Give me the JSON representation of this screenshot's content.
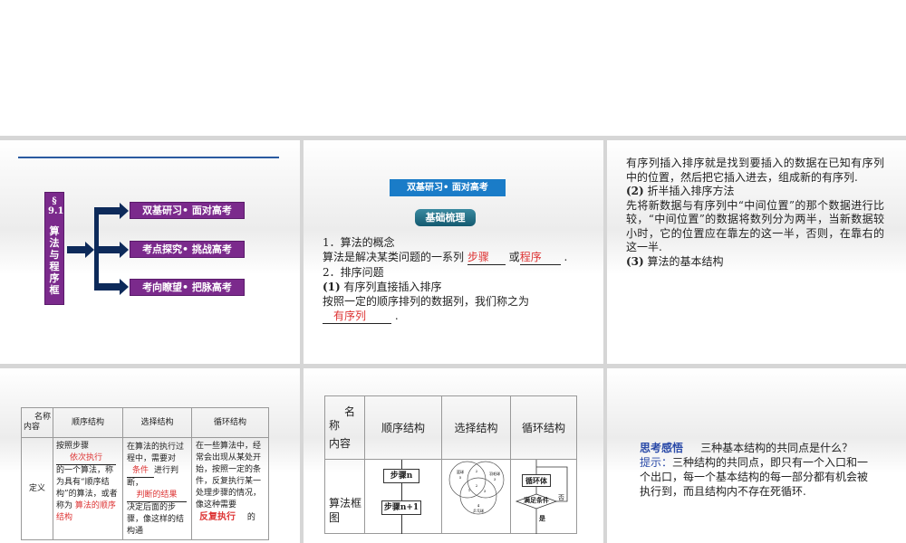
{
  "slide1": {
    "section": "§ 9.1",
    "title_chars": [
      "算",
      "法",
      "与",
      "程",
      "序",
      "框"
    ],
    "branches": [
      "双基研习• 面对高考",
      "考点探究• 挑战高考",
      "考向瞭望• 把脉高考"
    ]
  },
  "slide2": {
    "banner": "双基研习• 面对高考",
    "badge": "基础梳理",
    "l1": "1．算法的概念",
    "l2_pre": "算法是解决某类问题的一系列",
    "blank1": "步骤",
    "l2_mid": "或",
    "blank2": "程序",
    "l2_end": ".",
    "l3": "2．排序问题",
    "l4_num": "(1)",
    "l4": "有序列直接插入排序",
    "l5": "按照一定的顺序排列的数据列，我们称之为",
    "blank3": "有序列",
    "l6_end": "."
  },
  "slide3": {
    "p1": "有序列插入排序就是找到要插入的数据在已知有序列中的位置，然后把它插入进去，组成新的有序列.",
    "h2_num": "(2)",
    "h2": "折半插入排序方法",
    "p2": "先将新数据与有序列中“中间位置”的那个数据进行比较，“中间位置”的数据将数列分为两半，当新数据较小时，它的位置应在靠左的这一半，否则，在靠右的这一半.",
    "h3_num": "(3)",
    "h3": "算法的基本结构"
  },
  "slide4": {
    "corner_top": "名称",
    "corner_bottom": "内容",
    "cols": [
      "顺序结构",
      "选择结构",
      "循环结构"
    ],
    "row_label": "定义",
    "c1a": "按照步骤",
    "c1_blank": "依次执行",
    "c1b": "的一个算法，称为具有“顺序结构”的算法，或者称为",
    "c1_blank2": "算法的顺序结构",
    "c2a": "在算法的执行过程中，需要对",
    "c2_blank": "条件",
    "c2b": "进行判断，",
    "c2_blank2": "判断的结果",
    "c2c": "决定后面的步骤，像这样的结构通",
    "c3a": "在一些算法中，经常会出现从某处开始，按照一定的条件，反复执行某一处理步骤的情况，像这种需要",
    "c3_blank": "反复执行",
    "c3b": "的"
  },
  "slide5": {
    "corner_top": "名",
    "corner_mid": "称",
    "corner_bottom": "内容",
    "cols": [
      "顺序结构",
      "选择结构",
      "循环结构"
    ],
    "row_label": "算法框图",
    "seq_box1": "步骤n",
    "seq_box2": "步骤n+1",
    "venn": {
      "a": "篮球",
      "a_n": "5",
      "b": "羽毛球",
      "b_n": "3",
      "c": "乒乓球",
      "c_n": "4",
      "ab": "2",
      "abc": "2",
      "ac": "1",
      "bc": "3"
    },
    "loop_body": "循环体",
    "loop_cond": "满足条件",
    "loop_no": "否",
    "loop_yes": "是"
  },
  "slide6": {
    "label": "思考感悟",
    "question": "三种基本结构的共同点是什么？",
    "hint_label": "提示：",
    "hint": "三种结构的共同点，即只有一个入口和一个出口，每一个基本结构的每一部分都有机会被执行到，而且结构内不存在死循环."
  }
}
